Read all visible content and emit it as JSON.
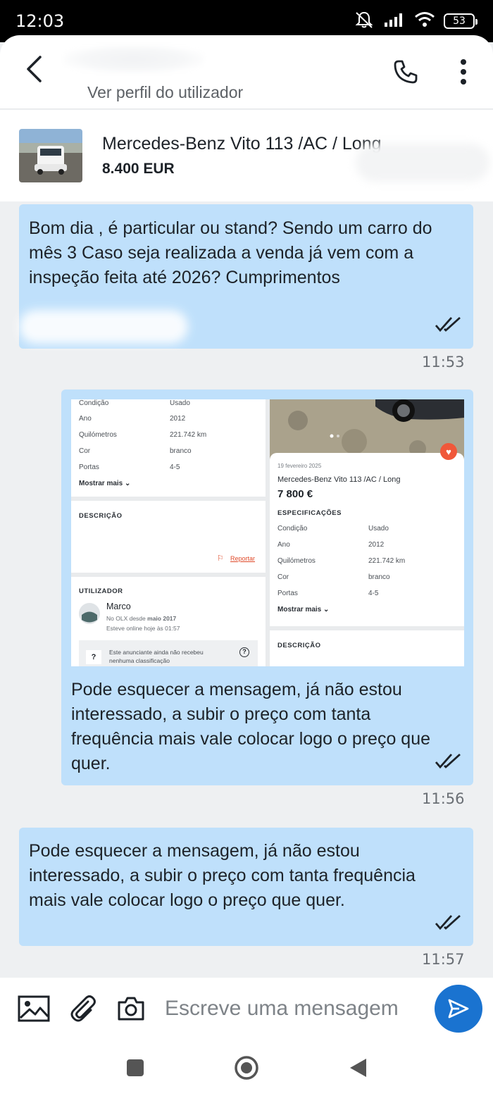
{
  "status_bar": {
    "time": "12:03",
    "battery": "53"
  },
  "header": {
    "profile_link": "Ver perfil do utilizador"
  },
  "ad": {
    "title": "Mercedes-Benz Vito 113 /AC / Long",
    "price": "8.400 EUR"
  },
  "messages": [
    {
      "text": "Bom dia , é particular ou stand? Sendo um carro do mês 3 Caso seja realizada a venda já vem com a inspeção feita até 2026? Cumprimentos",
      "time": "11:53"
    },
    {
      "text": "Pode esquecer a mensagem, já não estou interessado, a subir o preço com tanta frequência mais vale colocar logo o preço que quer.",
      "time": "11:56"
    },
    {
      "text": "Pode esquecer a mensagem, já não estou interessado, a subir o preço com tanta frequência mais vale colocar logo o preço que quer.",
      "time": "11:57"
    }
  ],
  "attachment": {
    "left": {
      "specs": [
        {
          "label": "Condição",
          "value": "Usado"
        },
        {
          "label": "Ano",
          "value": "2012"
        },
        {
          "label": "Quilómetros",
          "value": "221.742 km"
        },
        {
          "label": "Cor",
          "value": "branco"
        },
        {
          "label": "Portas",
          "value": "4-5"
        }
      ],
      "show_more": "Mostrar mais",
      "description_title": "DESCRIÇÃO",
      "report": "Reportar",
      "user_title": "UTILIZADOR",
      "user_name": "Marco",
      "user_since_prefix": "No OLX desde",
      "user_since": "maio 2017",
      "user_online": "Esteve online hoje às 01:57",
      "rating_note_1": "Este anunciante ainda não recebeu",
      "rating_note_2": "nenhuma classificação"
    },
    "right": {
      "date": "19 fevereiro 2025",
      "title": "Mercedes-Benz Vito 113 /AC / Long",
      "price": "7 800 €",
      "specs_title": "ESPECIFICAÇÕES",
      "specs": [
        {
          "label": "Condição",
          "value": "Usado"
        },
        {
          "label": "Ano",
          "value": "2012"
        },
        {
          "label": "Quilómetros",
          "value": "221.742 km"
        },
        {
          "label": "Cor",
          "value": "branco"
        },
        {
          "label": "Portas",
          "value": "4-5"
        }
      ],
      "show_more": "Mostrar mais",
      "description_title": "DESCRIÇÃO"
    }
  },
  "composer": {
    "placeholder": "Escreve uma mensagem"
  },
  "colors": {
    "bubble": "#bfe0fb",
    "send": "#1a73d0",
    "background": "#eef0f2",
    "heart": "#f0583a"
  }
}
